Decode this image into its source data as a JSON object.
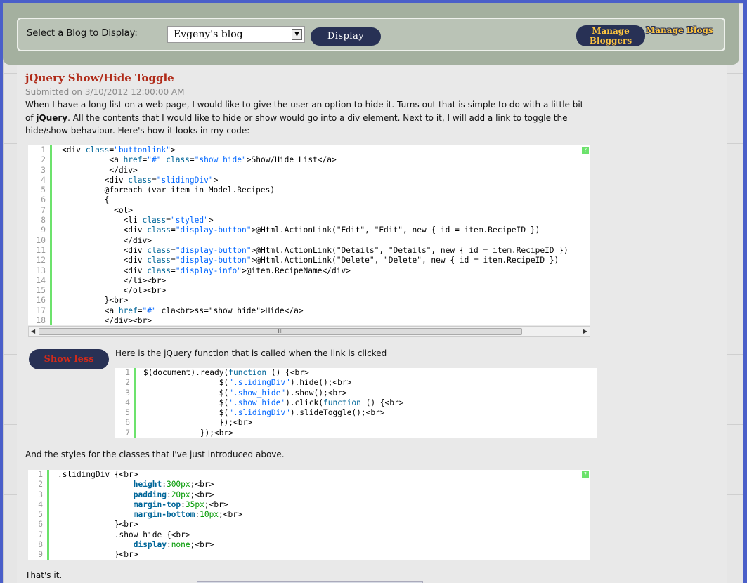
{
  "header": {
    "select_label": "Select a Blog to Display:",
    "selected_blog": "Evgeny's blog",
    "display_button": "Display",
    "manage_bloggers_line1": "Manage",
    "manage_bloggers_line2": "Bloggers",
    "manage_blogs": "Manage Blogs"
  },
  "post": {
    "title": "jQuery Show/Hide Toggle",
    "submitted": "Submitted on 3/10/2012 12:00:00 AM",
    "intro_1a": "When I have a long list on a web page, I would like to give the user an option to hide it. Turns out that is simple to do with a little bit",
    "intro_2a": "of ",
    "intro_2b": "jQuery",
    "intro_2c": ". All the contents that I would like to hide or show would go into a div element. Next to it, I will add a link to toggle the",
    "intro_3": "hide/show behaviour. Here's how it looks in my code:",
    "jquery_intro": "Here is the jQuery function that is called when the link is clicked",
    "styles_intro": "And the styles for the classes that I've just introduced above.",
    "outro": "That's it.",
    "show_less": "Show less"
  },
  "code_blocks": {
    "markup_line_numbers": [
      "1",
      "2",
      "3",
      "4",
      "5",
      "6",
      "7",
      "8",
      "9",
      "10",
      "11",
      "12",
      "13",
      "14",
      "15",
      "16",
      "17",
      "18"
    ],
    "js_line_numbers": [
      "1",
      "2",
      "3",
      "4",
      "5",
      "6",
      "7"
    ],
    "css_line_numbers": [
      "1",
      "2",
      "3",
      "4",
      "5",
      "6",
      "7",
      "8",
      "9"
    ],
    "help_glyph": "?",
    "scroll_left": "◀",
    "scroll_right": "▶",
    "scroll_grip": "III"
  },
  "colors": {
    "page_background": "#4a5fc9",
    "header": "#a4b09f",
    "button": "#283155",
    "accent_gold": "#ffc640",
    "title_red": "#b02a18",
    "gutter_green": "#6ce26c"
  }
}
